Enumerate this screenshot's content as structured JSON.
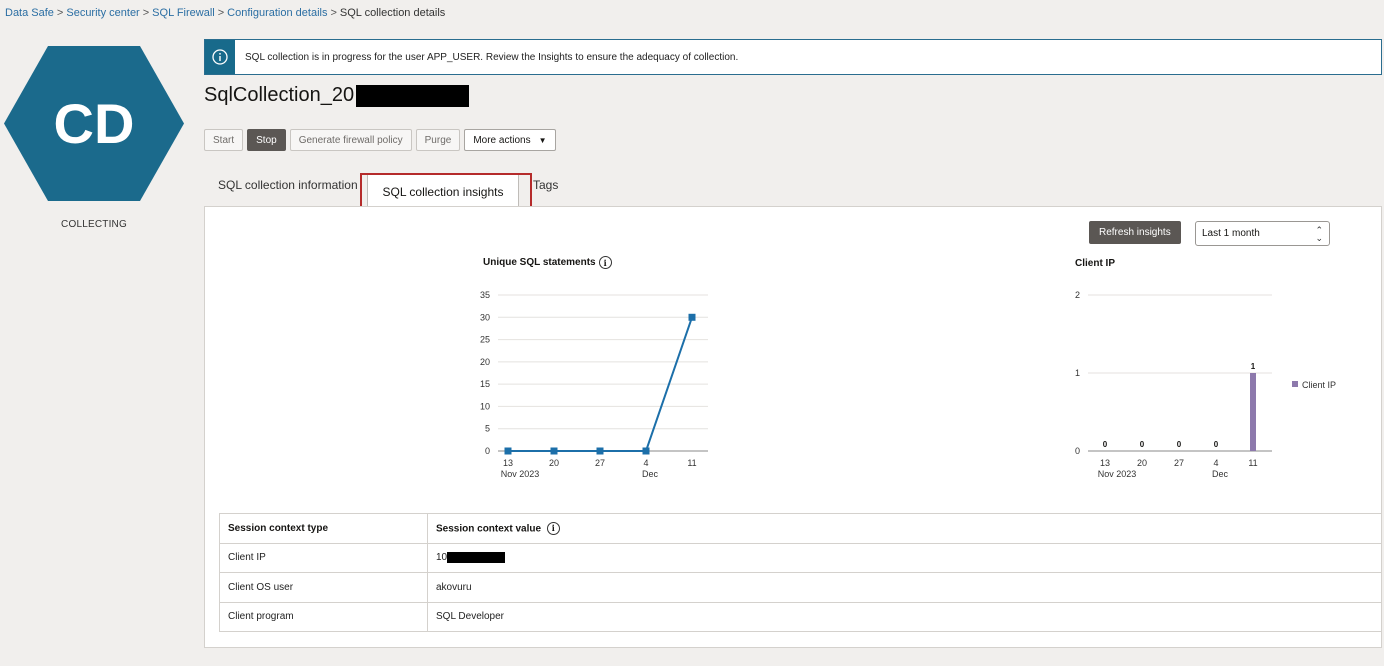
{
  "breadcrumb": {
    "items": [
      "Data Safe",
      "Security center",
      "SQL Firewall",
      "Configuration details"
    ],
    "separator": ">",
    "current": "SQL collection details"
  },
  "avatar": {
    "initials": "CD",
    "color": "#1b6a8c"
  },
  "status": "COLLECTING",
  "banner": {
    "icon": "info-icon",
    "text": "SQL collection is in progress for the user APP_USER. Review the Insights to ensure the adequacy of collection."
  },
  "page": {
    "title": "SqlCollection_20"
  },
  "actions": {
    "start": "Start",
    "stop": "Stop",
    "generate": "Generate firewall policy",
    "purge": "Purge",
    "more": "More actions"
  },
  "tabs": {
    "info": "SQL collection information",
    "insights": "SQL collection insights",
    "tags": "Tags"
  },
  "toolbar": {
    "refresh": "Refresh insights",
    "range": "Last 1 month"
  },
  "chart_data": [
    {
      "type": "line",
      "title": "Unique SQL statements",
      "x": [
        "13",
        "20",
        "27",
        "4",
        "11"
      ],
      "x_sublabels": [
        "Nov 2023",
        "",
        "",
        "Dec",
        ""
      ],
      "series": [
        {
          "values": [
            0,
            0,
            0,
            0,
            30
          ]
        }
      ],
      "yticks": [
        0,
        5,
        10,
        15,
        20,
        25,
        30,
        35
      ],
      "ylim": [
        0,
        35
      ],
      "color": "#1c6fa9",
      "grid": true
    },
    {
      "type": "bar",
      "title": "Client IP",
      "x": [
        "13",
        "20",
        "27",
        "4",
        "11"
      ],
      "x_sublabels": [
        "Nov 2023",
        "",
        "",
        "Dec",
        ""
      ],
      "series": [
        {
          "name": "Client IP",
          "values": [
            0,
            0,
            0,
            0,
            1
          ]
        }
      ],
      "data_labels": [
        "0",
        "0",
        "0",
        "0",
        "1"
      ],
      "yticks": [
        0,
        1,
        2
      ],
      "ylim": [
        0,
        2
      ],
      "color": "#8d79ac",
      "legend": "right",
      "grid": true
    }
  ],
  "context_table": {
    "headers": [
      "Session context type",
      "Session context value"
    ],
    "rows": [
      [
        "Client IP",
        "10"
      ],
      [
        "Client OS user",
        "akovuru"
      ],
      [
        "Client program",
        "SQL Developer"
      ]
    ]
  }
}
